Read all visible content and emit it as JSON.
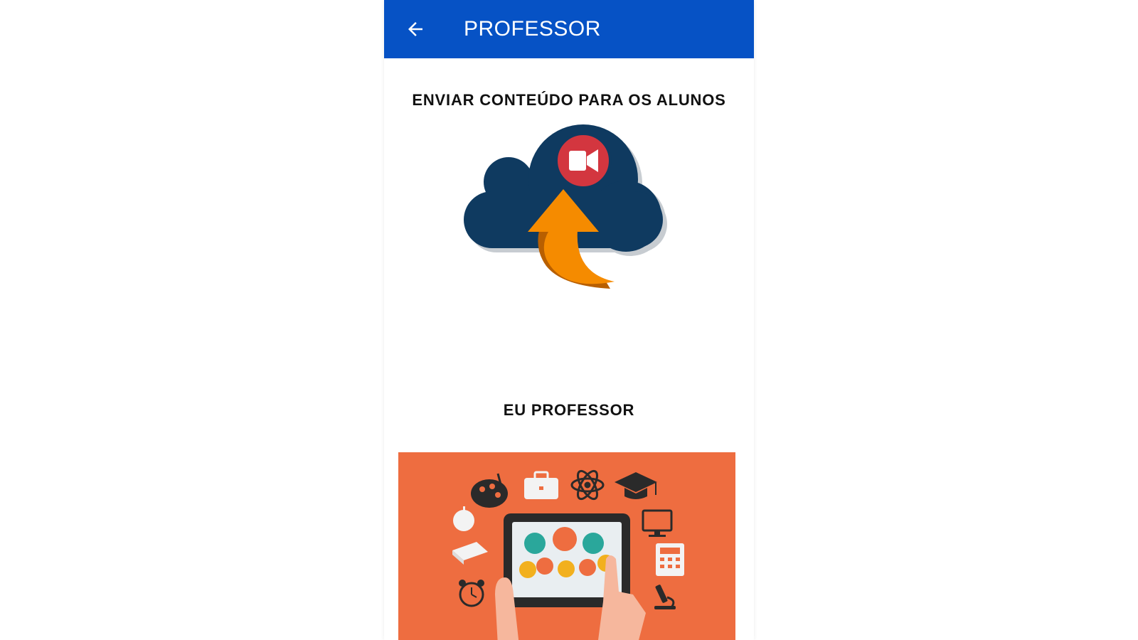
{
  "appbar": {
    "title": "PROFESSOR",
    "back_icon": "arrow-back-icon",
    "color": "#0652c5"
  },
  "sections": [
    {
      "title": "ENVIAR CONTEÚDO PARA OS ALUNOS",
      "icon": "cloud-upload-video-icon"
    },
    {
      "title": "EU PROFESSOR",
      "icon": "teacher-tablet-illustration"
    }
  ],
  "colors": {
    "cloud": "#0f3a60",
    "arrow": "#f58b00",
    "video_badge": "#d3363f",
    "banner": "#ee6d40"
  }
}
